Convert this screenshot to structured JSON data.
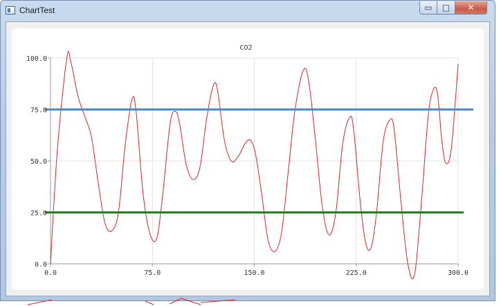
{
  "window": {
    "title": "ChartTest",
    "minimize_glyph": "▭",
    "maximize_glyph": "□",
    "close_glyph": "✕",
    "icons": [
      "app-icon",
      "minimize-icon",
      "maximize-icon",
      "close-icon"
    ]
  },
  "chart_data": {
    "type": "line",
    "title": "CO2",
    "xlabel": "",
    "ylabel": "",
    "xlim": [
      0,
      300
    ],
    "ylim": [
      0,
      100
    ],
    "x_ticks": [
      "0.0",
      "75.0",
      "150.0",
      "225.0",
      "300.0"
    ],
    "y_ticks": [
      "0.0",
      "25.0",
      "50.0",
      "75.0",
      "100.0"
    ],
    "grid": true,
    "series": [
      {
        "color": "#e02020",
        "points": [
          [
            0,
            0
          ],
          [
            5,
            55
          ],
          [
            12,
            100
          ],
          [
            15,
            98
          ],
          [
            20,
            82
          ],
          [
            25,
            72
          ],
          [
            30,
            62
          ],
          [
            35,
            40
          ],
          [
            40,
            20
          ],
          [
            45,
            16
          ],
          [
            50,
            25
          ],
          [
            55,
            58
          ],
          [
            60,
            80
          ],
          [
            63,
            74
          ],
          [
            68,
            35
          ],
          [
            73,
            15
          ],
          [
            78,
            12
          ],
          [
            82,
            30
          ],
          [
            88,
            68
          ],
          [
            92,
            74
          ],
          [
            95,
            68
          ],
          [
            100,
            48
          ],
          [
            105,
            41
          ],
          [
            110,
            47
          ],
          [
            115,
            71
          ],
          [
            120,
            87
          ],
          [
            123,
            84
          ],
          [
            128,
            60
          ],
          [
            133,
            50
          ],
          [
            138,
            52
          ],
          [
            145,
            60
          ],
          [
            150,
            56
          ],
          [
            155,
            36
          ],
          [
            160,
            12
          ],
          [
            165,
            6
          ],
          [
            170,
            15
          ],
          [
            175,
            45
          ],
          [
            180,
            75
          ],
          [
            186,
            94
          ],
          [
            190,
            89
          ],
          [
            195,
            60
          ],
          [
            200,
            28
          ],
          [
            205,
            14
          ],
          [
            210,
            25
          ],
          [
            215,
            58
          ],
          [
            220,
            71
          ],
          [
            223,
            66
          ],
          [
            228,
            30
          ],
          [
            232,
            10
          ],
          [
            236,
            8
          ],
          [
            240,
            25
          ],
          [
            245,
            60
          ],
          [
            250,
            70
          ],
          [
            253,
            65
          ],
          [
            258,
            30
          ],
          [
            263,
            0
          ],
          [
            268,
            -5
          ],
          [
            273,
            30
          ],
          [
            278,
            72
          ],
          [
            282,
            85
          ],
          [
            285,
            82
          ],
          [
            288,
            60
          ],
          [
            291,
            49
          ],
          [
            295,
            56
          ],
          [
            300,
            97
          ]
        ]
      }
    ],
    "reference_lines": [
      {
        "y": 75,
        "color": "#3a8fe0",
        "extends_past_axis": true
      },
      {
        "y": 25,
        "color": "#2a7a2a",
        "extends_past_axis": true
      }
    ]
  }
}
